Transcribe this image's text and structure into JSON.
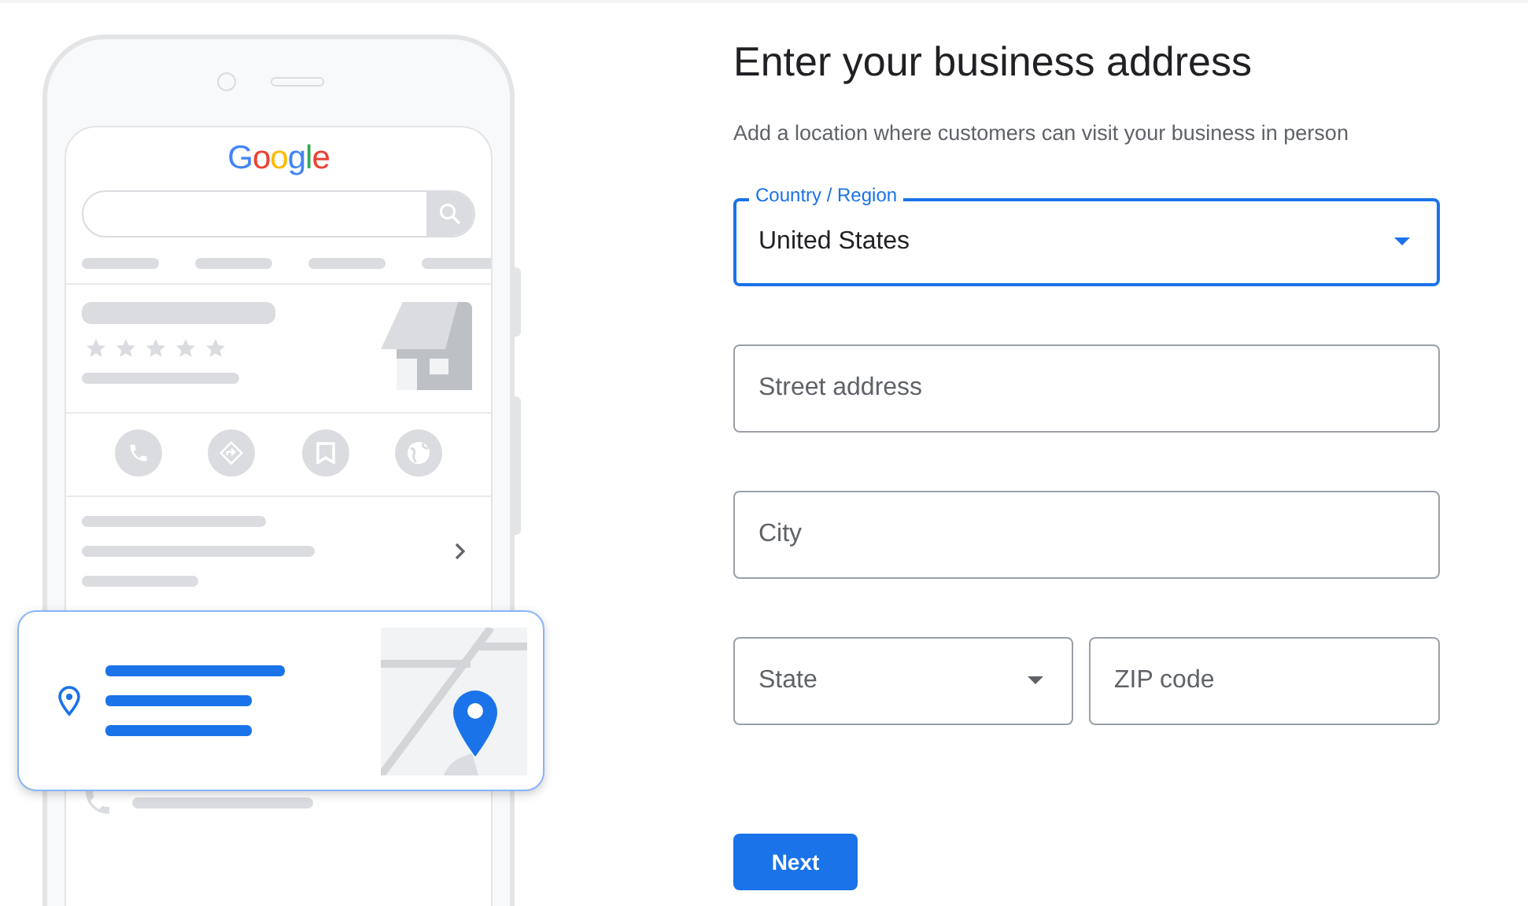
{
  "illustration": {
    "logo_text": "Google"
  },
  "heading": "Enter your business address",
  "subtitle": "Add a location where customers can visit your business in person",
  "field_rows": [
    [
      {
        "kind": "select",
        "label": "Country / Region",
        "value": "United States",
        "focused": true
      }
    ],
    [
      {
        "kind": "text",
        "placeholder": "Street address",
        "focused": false
      }
    ],
    [
      {
        "kind": "text",
        "placeholder": "City",
        "focused": false
      }
    ],
    [
      {
        "kind": "select",
        "placeholder": "State",
        "focused": false
      },
      {
        "kind": "text",
        "placeholder": "ZIP code",
        "focused": false
      }
    ]
  ],
  "next_button": "Next"
}
